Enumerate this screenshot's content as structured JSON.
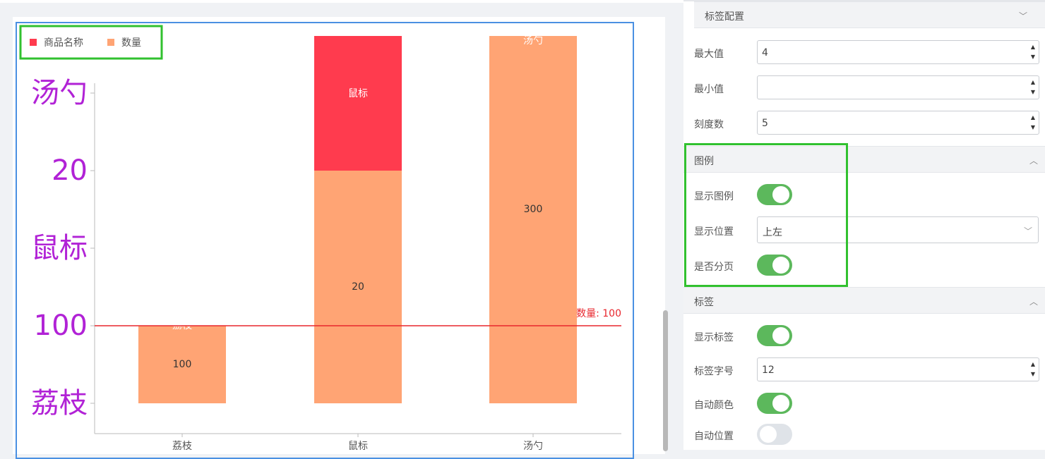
{
  "colors": {
    "series_name": "#ff3b4e",
    "series_qty": "#ffa474",
    "axis_label": "#b122d6",
    "refline": "#e8262d",
    "highlight": "#31c12f",
    "frame": "#4a90e2",
    "toggle_on": "#5cb85c"
  },
  "chart_data": {
    "type": "bar",
    "stacked": true,
    "categories": [
      "荔枝",
      "鼠标",
      "汤勺"
    ],
    "series": [
      {
        "name": "商品名称",
        "values": [
          null,
          20,
          null
        ],
        "labels": [
          "荔枝",
          "鼠标",
          "汤勺"
        ]
      },
      {
        "name": "数量",
        "values": [
          100,
          20,
          300
        ],
        "labels": [
          "100",
          "20",
          "300"
        ]
      }
    ],
    "y_tick_labels": [
      "荔枝",
      "100",
      "鼠标",
      "20",
      "汤勺"
    ],
    "legend": {
      "position": "top-left",
      "items": [
        "商品名称",
        "数量"
      ]
    },
    "reference_line": {
      "label": "数量: 100"
    },
    "grid": false
  },
  "panel": {
    "label_config": {
      "title": "标签配置"
    },
    "max_value": {
      "label": "最大值",
      "value": "4"
    },
    "min_value": {
      "label": "最小值",
      "value": ""
    },
    "tick_count": {
      "label": "刻度数",
      "value": "5"
    },
    "legend_section": {
      "title": "图例",
      "show_legend": {
        "label": "显示图例",
        "on": true
      },
      "position": {
        "label": "显示位置",
        "value": "上左"
      },
      "paging": {
        "label": "是否分页",
        "on": true
      }
    },
    "label_section": {
      "title": "标签",
      "show_label": {
        "label": "显示标签",
        "on": true
      },
      "font_size": {
        "label": "标签字号",
        "value": "12"
      },
      "auto_color": {
        "label": "自动颜色",
        "on": true
      },
      "auto_position": {
        "label": "自动位置",
        "on": false
      }
    }
  }
}
